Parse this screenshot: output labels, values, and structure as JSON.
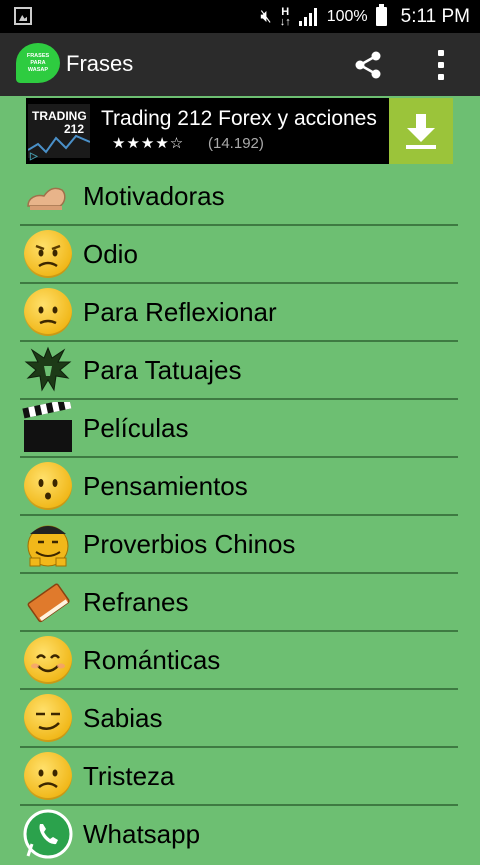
{
  "status_bar": {
    "network_type": "H",
    "battery_percent": "100%",
    "time": "5:11 PM"
  },
  "app_bar": {
    "title": "Frases",
    "logo_text": [
      "FRASES",
      "PARA",
      "WASAP"
    ]
  },
  "ad": {
    "logo_line1": "TRADING",
    "logo_line2": "212",
    "title": "Trading 212 Forex y acciones",
    "stars": "★★★★☆",
    "rating_count": "(14.192)",
    "rating_value": 4,
    "colors": {
      "download_bg": "#9bc43a"
    }
  },
  "categories": [
    {
      "label": "Motivadoras",
      "icon": "flexed-arm-icon"
    },
    {
      "label": "Odio",
      "icon": "angry-face-icon"
    },
    {
      "label": "Para Reflexionar",
      "icon": "pensive-face-icon"
    },
    {
      "label": "Para Tatuajes",
      "icon": "tribal-dragon-icon"
    },
    {
      "label": "Películas",
      "icon": "clapperboard-icon"
    },
    {
      "label": "Pensamientos",
      "icon": "thinking-face-icon"
    },
    {
      "label": "Proverbios Chinos",
      "icon": "chinese-man-icon"
    },
    {
      "label": "Refranes",
      "icon": "book-icon"
    },
    {
      "label": "Románticas",
      "icon": "smiling-face-icon"
    },
    {
      "label": "Sabias",
      "icon": "smirking-face-icon"
    },
    {
      "label": "Tristeza",
      "icon": "sad-face-icon"
    },
    {
      "label": "Whatsapp",
      "icon": "whatsapp-icon"
    }
  ],
  "colors": {
    "list_background": "#6dbf72",
    "separator": "#3e7a42",
    "action_bar": "#2b2b2b"
  }
}
